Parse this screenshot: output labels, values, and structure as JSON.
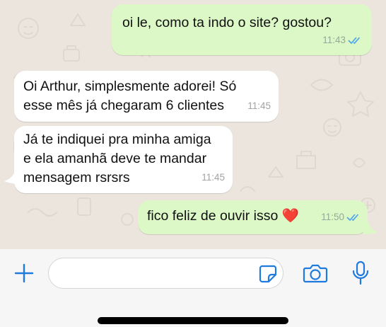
{
  "messages": [
    {
      "direction": "outgoing",
      "lines": [
        "oi le, como ta indo o site? gostou?"
      ],
      "time": "11:43",
      "status": "read"
    },
    {
      "direction": "incoming",
      "lines": [
        "Oi Arthur, simplesmente adorei! Só",
        "esse mês já chegaram 6 clientes"
      ],
      "time": "11:45"
    },
    {
      "direction": "incoming",
      "lines": [
        "Já te indiquei pra minha amiga",
        "e ela amanhã deve te mandar",
        "mensagem rsrsrs"
      ],
      "time": "11:45"
    },
    {
      "direction": "outgoing",
      "lines": [
        "fico feliz de ouvir isso ❤️"
      ],
      "time": "11:50",
      "status": "read"
    }
  ],
  "composer": {
    "placeholder": "",
    "icons": [
      "plus-icon",
      "sticker-icon",
      "camera-icon",
      "microphone-icon"
    ]
  },
  "colors": {
    "accent": "#1f7ae0",
    "outgoing_bubble": "#dcf8c6",
    "incoming_bubble": "#ffffff",
    "read_ticks": "#4fa6e8",
    "chat_background": "#ece5dd"
  }
}
